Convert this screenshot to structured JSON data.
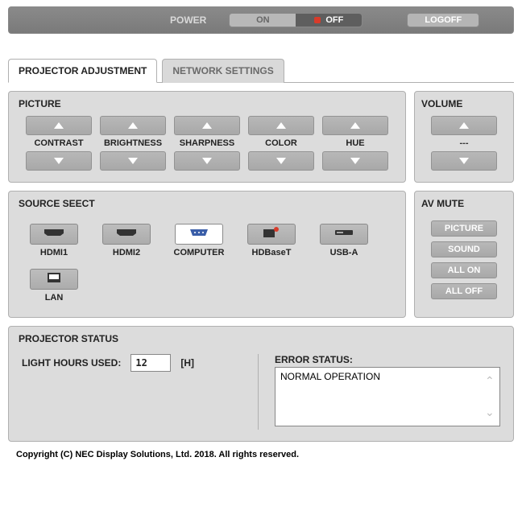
{
  "topbar": {
    "power_label": "POWER",
    "on": "ON",
    "off": "OFF",
    "logoff": "LOGOFF"
  },
  "tabs": [
    {
      "label": "PROJECTOR ADJUSTMENT",
      "active": true
    },
    {
      "label": "NETWORK SETTINGS",
      "active": false
    }
  ],
  "picture": {
    "title": "PICTURE",
    "items": [
      "CONTRAST",
      "BRIGHTNESS",
      "SHARPNESS",
      "COLOR",
      "HUE"
    ]
  },
  "volume": {
    "title": "VOLUME",
    "value": "---"
  },
  "source": {
    "title": "SOURCE SEECT",
    "items": [
      {
        "label": "HDMI1",
        "icon": "hdmi"
      },
      {
        "label": "HDMI2",
        "icon": "hdmi"
      },
      {
        "label": "COMPUTER",
        "icon": "vga",
        "active": true
      },
      {
        "label": "HDBaseT",
        "icon": "hdbaset"
      },
      {
        "label": "USB-A",
        "icon": "usb"
      },
      {
        "label": "LAN",
        "icon": "lan"
      }
    ]
  },
  "avmute": {
    "title": "AV MUTE",
    "buttons": [
      "PICTURE",
      "SOUND",
      "ALL ON",
      "ALL OFF"
    ]
  },
  "status": {
    "title": "PROJECTOR STATUS",
    "hours_label": "LIGHT HOURS USED:",
    "hours_value": "12",
    "hours_unit": "[H]",
    "error_label": "ERROR STATUS:",
    "error_text": "NORMAL OPERATION"
  },
  "footer": "Copyright (C) NEC Display Solutions, Ltd. 2018. All rights reserved."
}
